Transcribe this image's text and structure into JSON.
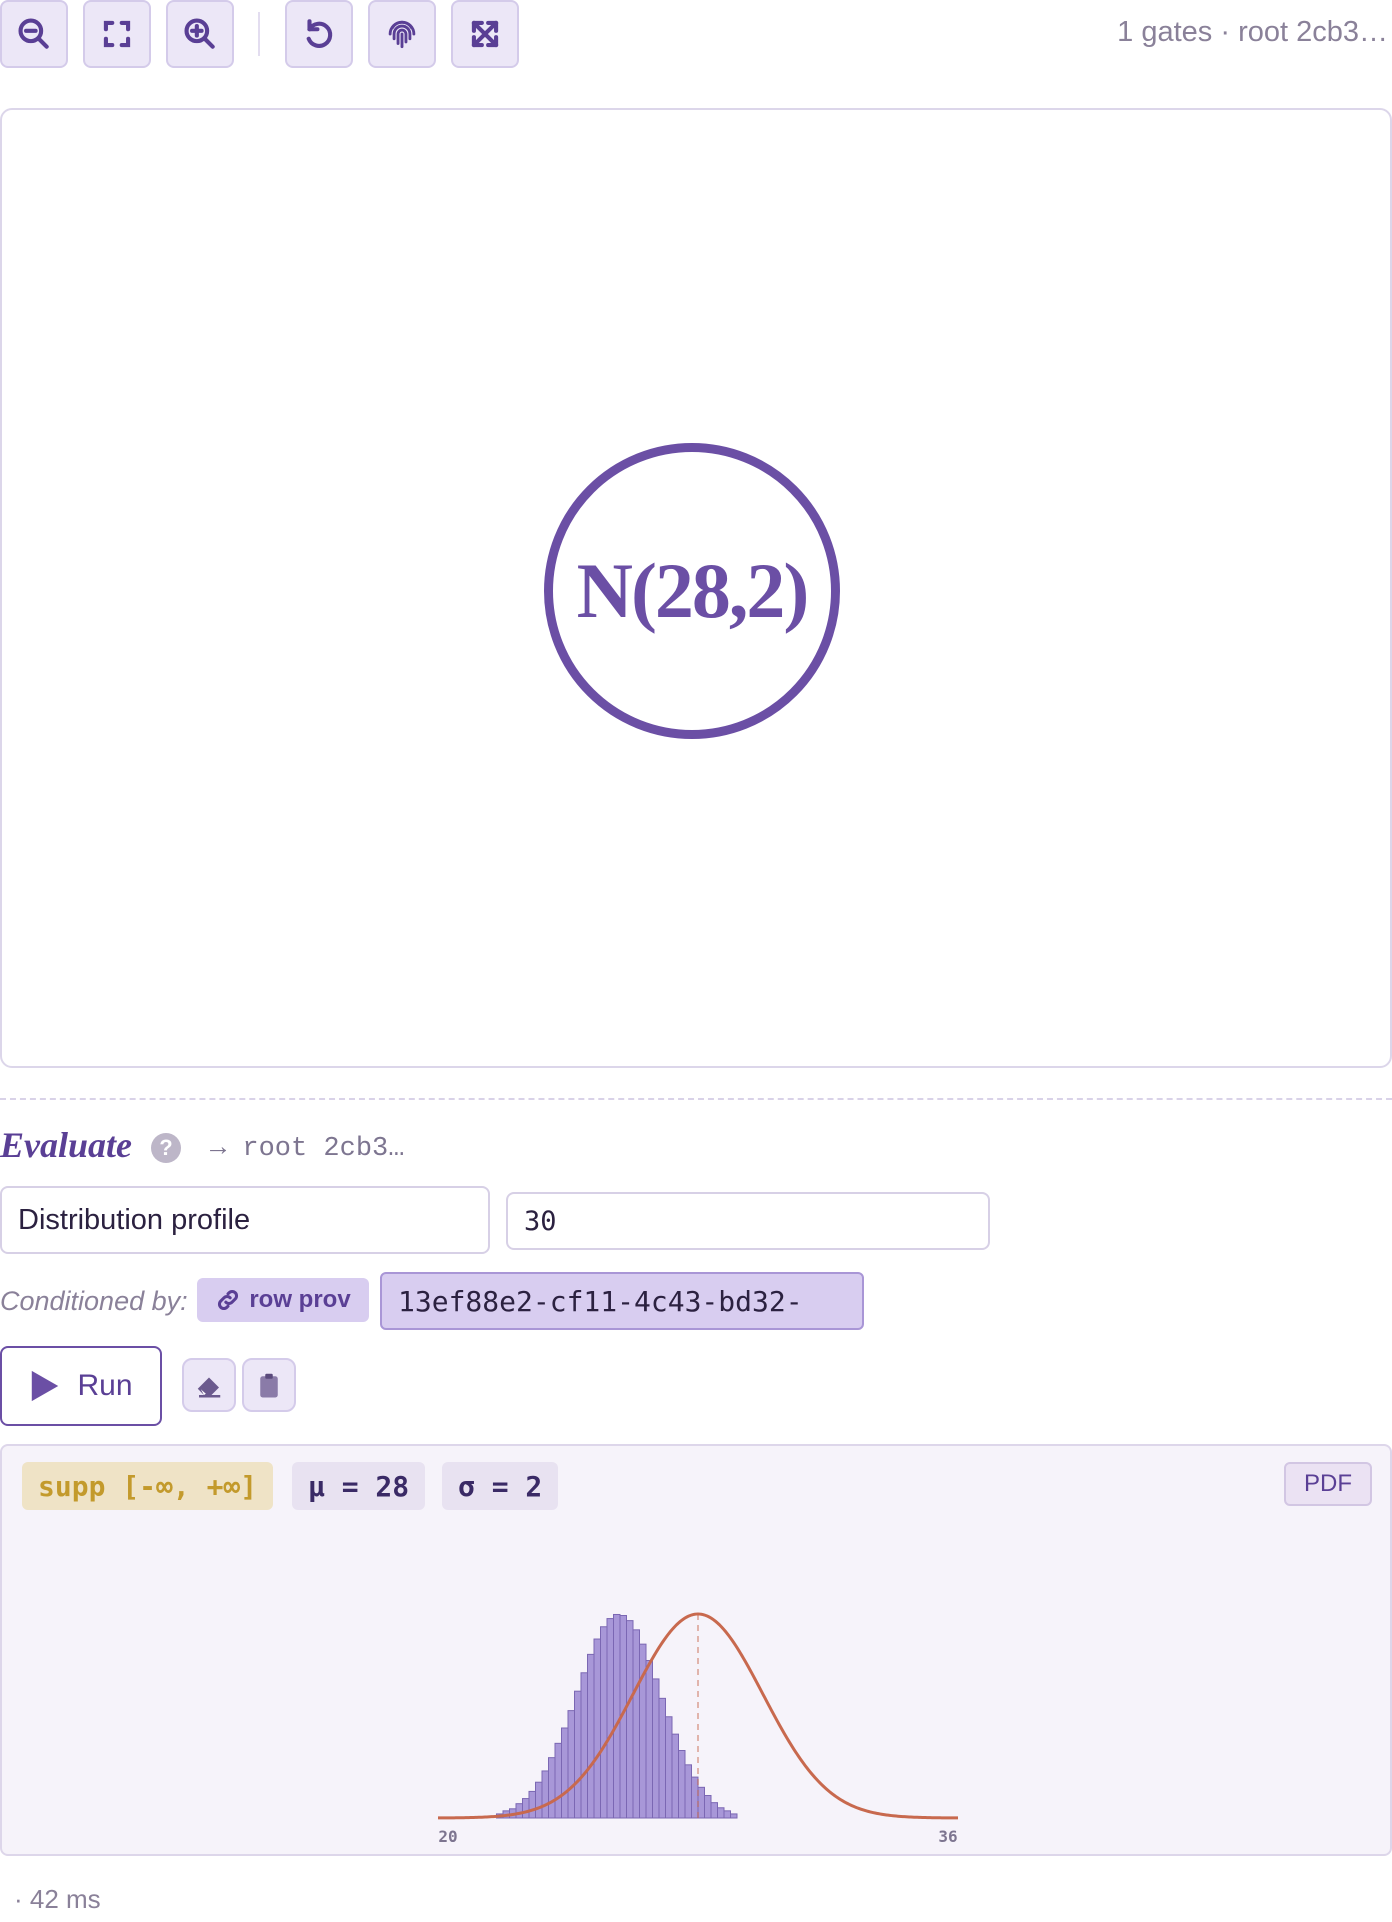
{
  "toolbar": {
    "buttons": [
      {
        "name": "zoom-out",
        "icon": "zoom-out-icon"
      },
      {
        "name": "fit",
        "icon": "fit-screen-icon"
      },
      {
        "name": "zoom-in",
        "icon": "zoom-in-icon"
      },
      {
        "name": "reset",
        "icon": "undo-icon"
      },
      {
        "name": "fingerprint",
        "icon": "fingerprint-icon"
      },
      {
        "name": "fullscreen",
        "icon": "expand-arrows-icon"
      }
    ],
    "meta": "1 gates · root 2cb3…"
  },
  "canvas": {
    "node_label": "N(28,2)"
  },
  "evaluate": {
    "title": "Evaluate",
    "help": "?",
    "root": "→ root 2cb3…",
    "select_value": "Distribution profile",
    "input_value": "30",
    "conditioned_label": "Conditioned by:",
    "row_prov_label": "row prov",
    "conditioned_value": "13ef88e2-cf11-4c43-bd32-",
    "run_label": "Run"
  },
  "result": {
    "supp": "supp [-∞, +∞]",
    "mu": "μ = 28",
    "sigma": "σ = 2",
    "pdf_label": "PDF"
  },
  "chart_data": {
    "type": "bar",
    "mean": 28,
    "std": 2,
    "x_range": [
      20,
      36
    ],
    "xticks": [
      "20",
      "36"
    ],
    "bin_start": 21.8,
    "bin_width": 0.2,
    "values": [
      0.004,
      0.007,
      0.009,
      0.014,
      0.019,
      0.026,
      0.035,
      0.046,
      0.059,
      0.073,
      0.088,
      0.105,
      0.124,
      0.142,
      0.16,
      0.175,
      0.187,
      0.195,
      0.199,
      0.198,
      0.193,
      0.184,
      0.17,
      0.154,
      0.136,
      0.117,
      0.099,
      0.082,
      0.066,
      0.052,
      0.04,
      0.03,
      0.022,
      0.015,
      0.01,
      0.007,
      0.004
    ],
    "colors": {
      "bars": "#a897d8",
      "bar_stroke": "#7b67b3",
      "curve": "#c8694e"
    }
  },
  "footer": {
    "timing": "· 42 ms"
  }
}
